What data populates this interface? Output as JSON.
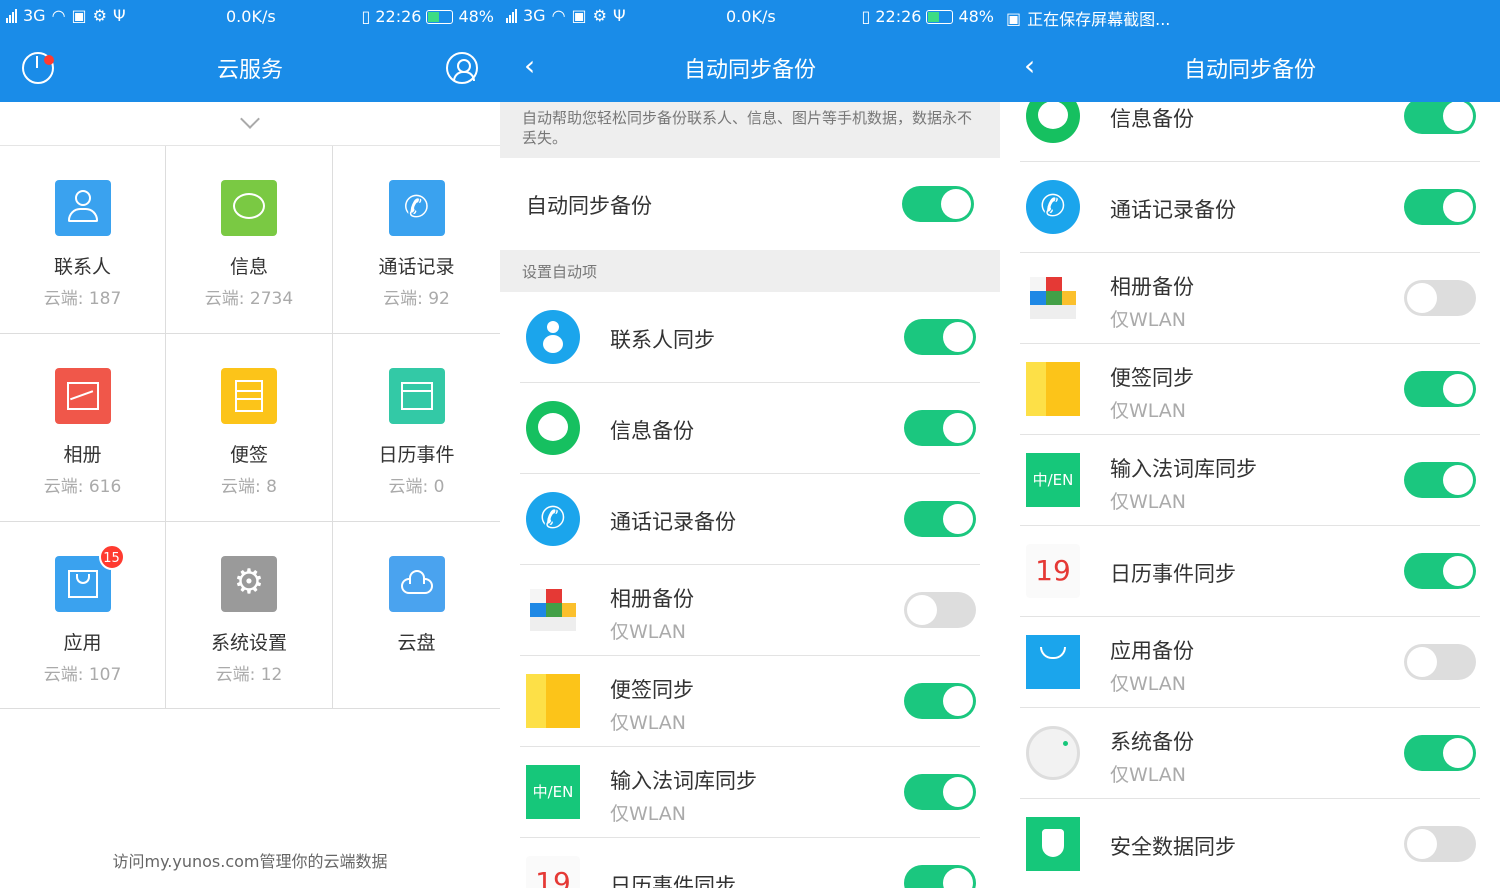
{
  "status": {
    "carrier": "3G",
    "speed": "0.0K/s",
    "time": "22:26",
    "battery": "48%",
    "saving": "正在保存屏幕截图..."
  },
  "screen1": {
    "title": "云服务",
    "grid": [
      {
        "name": "联系人",
        "count": "云端: 187",
        "icon": "contacts-icon",
        "color": "#3aa2ef"
      },
      {
        "name": "信息",
        "count": "云端: 2734",
        "icon": "message-icon",
        "color": "#7ac943"
      },
      {
        "name": "通话记录",
        "count": "云端: 92",
        "icon": "phone-icon",
        "color": "#3aa2ef"
      },
      {
        "name": "相册",
        "count": "云端: 616",
        "icon": "gallery-icon",
        "color": "#f0574a"
      },
      {
        "name": "便签",
        "count": "云端: 8",
        "icon": "notes-icon",
        "color": "#fcc419"
      },
      {
        "name": "日历事件",
        "count": "云端: 0",
        "icon": "calendar-icon",
        "color": "#33c9a6"
      },
      {
        "name": "应用",
        "count": "云端: 107",
        "icon": "app-store-icon",
        "color": "#3aa2ef",
        "badge": "15"
      },
      {
        "name": "系统设置",
        "count": "云端: 12",
        "icon": "gear-icon",
        "color": "#9a9a9a"
      },
      {
        "name": "云盘",
        "count": "",
        "icon": "cloud-icon",
        "color": "#4aa3ef"
      }
    ],
    "footer": "访问my.yunos.com管理你的云端数据"
  },
  "screen2": {
    "title": "自动同步备份",
    "description": "自动帮助您轻松同步备份联系人、信息、图片等手机数据，数据永不丢失。",
    "main_label": "自动同步备份",
    "section": "设置自动项",
    "items": [
      {
        "label": "联系人同步",
        "sub": "",
        "on": true
      },
      {
        "label": "信息备份",
        "sub": "",
        "on": true
      },
      {
        "label": "通话记录备份",
        "sub": "",
        "on": true
      },
      {
        "label": "相册备份",
        "sub": "仅WLAN",
        "on": false
      },
      {
        "label": "便签同步",
        "sub": "仅WLAN",
        "on": true
      },
      {
        "label": "输入法词库同步",
        "sub": "仅WLAN",
        "on": true
      },
      {
        "label": "日历事件同步",
        "sub": "",
        "on": true
      }
    ]
  },
  "screen3": {
    "title": "自动同步备份",
    "items": [
      {
        "label": "信息备份",
        "sub": "",
        "on": true
      },
      {
        "label": "通话记录备份",
        "sub": "",
        "on": true
      },
      {
        "label": "相册备份",
        "sub": "仅WLAN",
        "on": false
      },
      {
        "label": "便签同步",
        "sub": "仅WLAN",
        "on": true
      },
      {
        "label": "输入法词库同步",
        "sub": "仅WLAN",
        "on": true
      },
      {
        "label": "日历事件同步",
        "sub": "",
        "on": true
      },
      {
        "label": "应用备份",
        "sub": "仅WLAN",
        "on": false
      },
      {
        "label": "系统备份",
        "sub": "仅WLAN",
        "on": true
      },
      {
        "label": "安全数据同步",
        "sub": "",
        "on": false
      }
    ]
  },
  "icon_text": {
    "ime": "中/EN",
    "calendar": "19"
  }
}
